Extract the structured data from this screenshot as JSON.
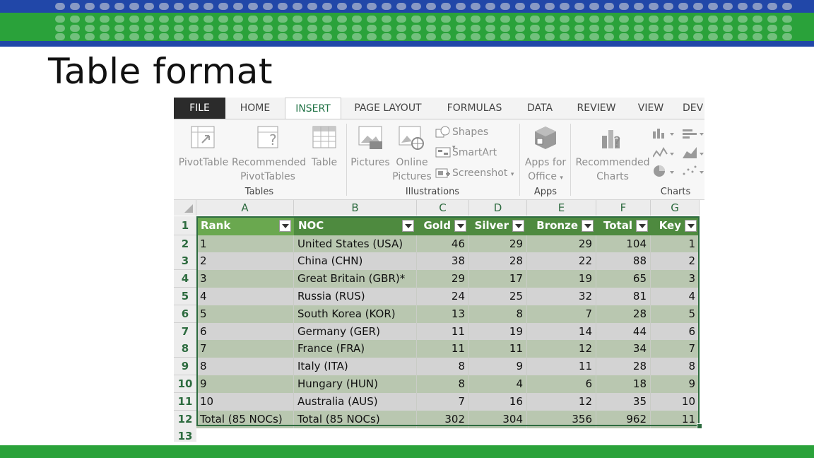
{
  "slide": {
    "title": "Table format"
  },
  "ribbon": {
    "tabs": [
      "FILE",
      "HOME",
      "INSERT",
      "PAGE LAYOUT",
      "FORMULAS",
      "DATA",
      "REVIEW",
      "VIEW",
      "DEV"
    ],
    "active_tab": "INSERT",
    "buttons": {
      "pivottable": "PivotTable",
      "recommended_pivot_1": "Recommended",
      "recommended_pivot_2": "PivotTables",
      "table": "Table",
      "pictures": "Pictures",
      "online_pictures_1": "Online",
      "online_pictures_2": "Pictures",
      "shapes": "Shapes",
      "smartart": "SmartArt",
      "screenshot": "Screenshot",
      "apps_1": "Apps for",
      "apps_2": "Office",
      "recommended_charts_1": "Recommended",
      "recommended_charts_2": "Charts"
    },
    "groups": {
      "tables": "Tables",
      "illustrations": "Illustrations",
      "apps": "Apps",
      "charts": "Charts"
    }
  },
  "sheet": {
    "columns": [
      "A",
      "B",
      "C",
      "D",
      "E",
      "F",
      "G"
    ],
    "row_numbers": [
      "1",
      "2",
      "3",
      "4",
      "5",
      "6",
      "7",
      "8",
      "9",
      "10",
      "11",
      "12",
      "13"
    ],
    "table_headers": [
      "Rank",
      "NOC",
      "Gold",
      "Silver",
      "Bronze",
      "Total",
      "Key"
    ],
    "rows": [
      [
        "1",
        "United States (USA)",
        "46",
        "29",
        "29",
        "104",
        "1"
      ],
      [
        "2",
        "China (CHN)",
        "38",
        "28",
        "22",
        "88",
        "2"
      ],
      [
        "3",
        "Great Britain (GBR)*",
        "29",
        "17",
        "19",
        "65",
        "3"
      ],
      [
        "4",
        "Russia (RUS)",
        "24",
        "25",
        "32",
        "81",
        "4"
      ],
      [
        "5",
        "South Korea (KOR)",
        "13",
        "8",
        "7",
        "28",
        "5"
      ],
      [
        "6",
        "Germany (GER)",
        "11",
        "19",
        "14",
        "44",
        "6"
      ],
      [
        "7",
        "France (FRA)",
        "11",
        "11",
        "12",
        "34",
        "7"
      ],
      [
        "8",
        "Italy (ITA)",
        "8",
        "9",
        "11",
        "28",
        "8"
      ],
      [
        "9",
        "Hungary (HUN)",
        "8",
        "4",
        "6",
        "18",
        "9"
      ],
      [
        "10",
        "Australia (AUS)",
        "7",
        "16",
        "12",
        "35",
        "10"
      ]
    ],
    "total_row": [
      "Total (85 NOCs)",
      "Total (85 NOCs)",
      "302",
      "304",
      "356",
      "962",
      "11"
    ],
    "colors": {
      "header_green": "#4e8a3f",
      "band_dark": "#b9c7b0",
      "band_light": "#d3d3d3",
      "accent": "#217346"
    }
  }
}
